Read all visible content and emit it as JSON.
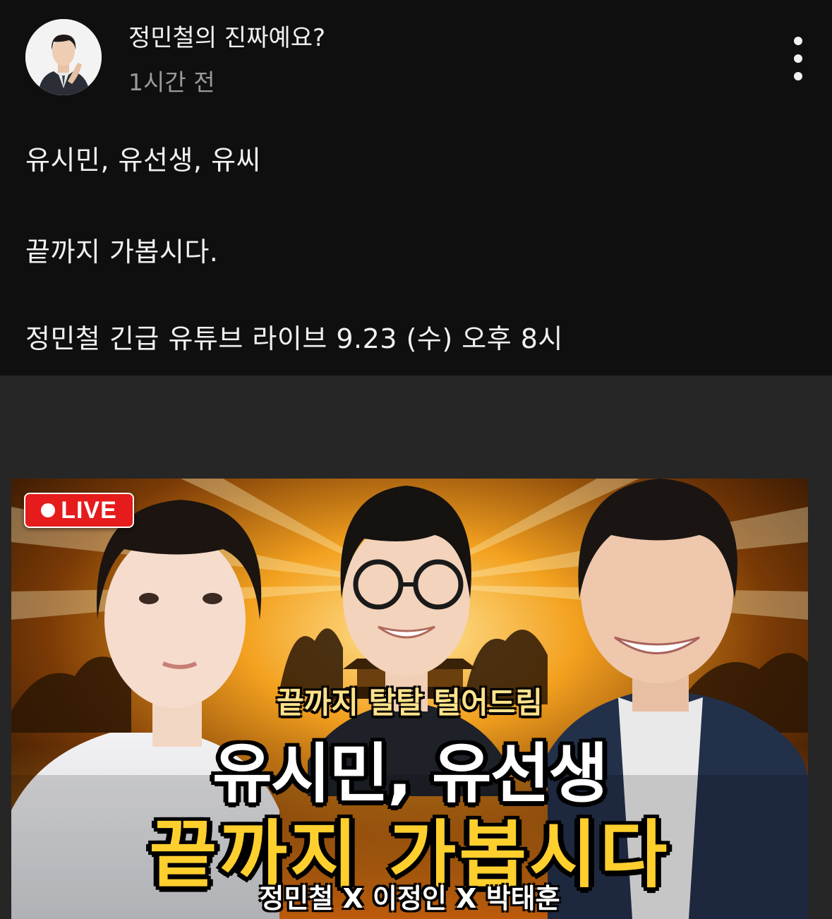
{
  "post": {
    "channel_name": "정민철의 진짜예요?",
    "time": "1시간 전",
    "menu_icon": "more-vertical-icon",
    "lines": [
      "유시민, 유선생, 유씨",
      "끝까지 가봅시다.",
      "정민철 긴급 유튜브 라이브 9.23 (수) 오후 8시"
    ]
  },
  "thumbnail": {
    "live_label": "LIVE",
    "subtitle": "끝까지 탈탈 털어드림",
    "title_line1": "유시민, 유선생",
    "title_line2": "끝까지 가봅시다",
    "names": "정민철 X 이정인 X 박태훈"
  },
  "colors": {
    "background": "#0f0f0f",
    "media_background": "#262626",
    "live_red": "#e61c1c",
    "title_yellow": "#ffcf2e",
    "subtitle_yellow": "#ffe28a",
    "secondary_text": "#9a9a9a"
  }
}
